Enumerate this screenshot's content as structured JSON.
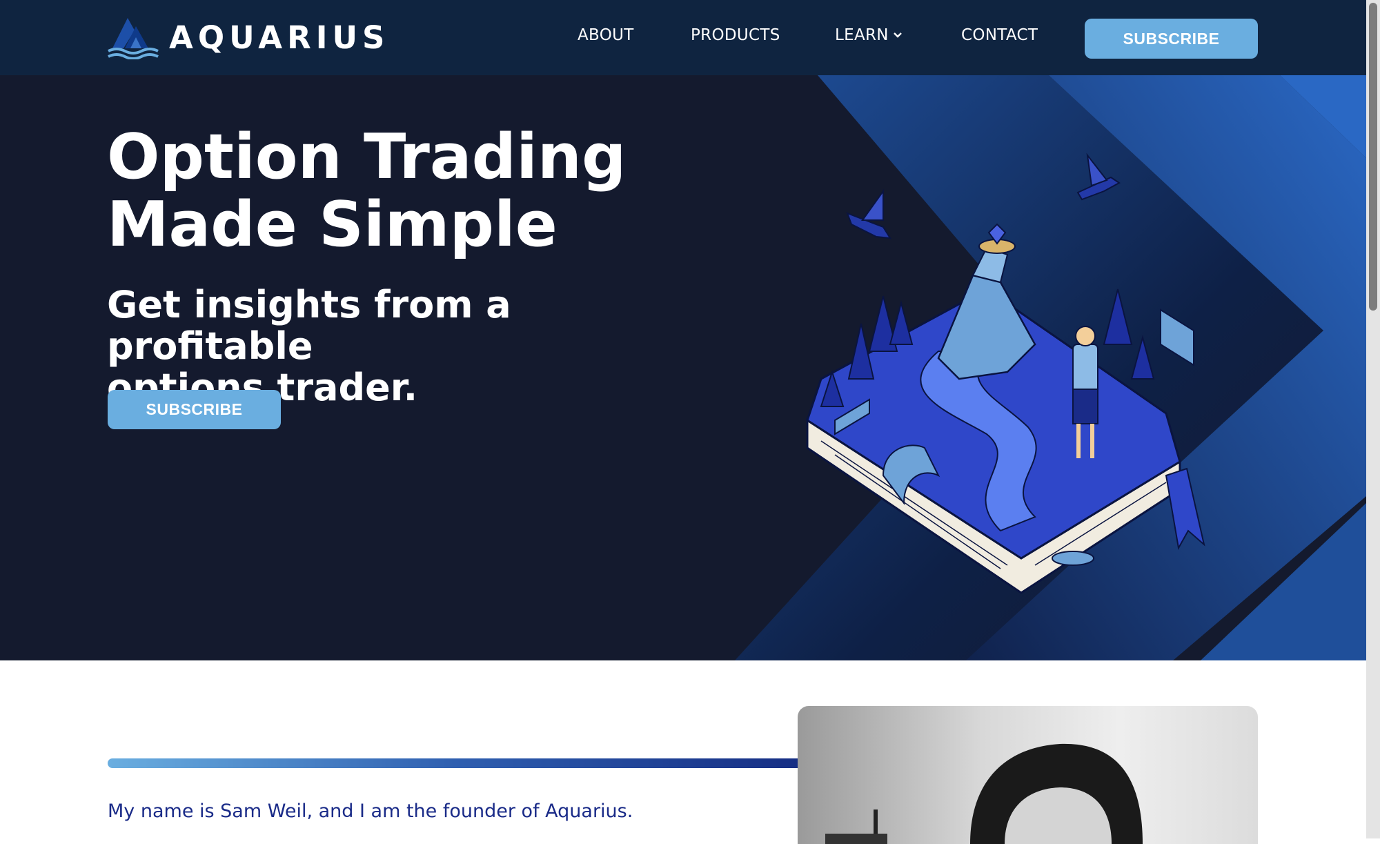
{
  "header": {
    "brand": "AQUARIUS",
    "nav": [
      "ABOUT",
      "PRODUCTS",
      "LEARN",
      "CONTACT"
    ],
    "subscribe_label": "SUBSCRIBE"
  },
  "hero": {
    "title_line1": "Option Trading",
    "title_line2": "Made Simple",
    "subtitle_line1": "Get insights from a profitable",
    "subtitle_line2": "options trader.",
    "subscribe_label": "SUBSCRIBE"
  },
  "about": {
    "intro": "My name is Sam Weil, and I am the founder of Aquarius."
  },
  "colors": {
    "header_bg": "#0f2440",
    "hero_bg": "#141a2e",
    "accent": "#6aaee0",
    "text_blue": "#1a2b88"
  },
  "icons": [
    "aquarius-logo-icon",
    "chevron-down-icon"
  ]
}
